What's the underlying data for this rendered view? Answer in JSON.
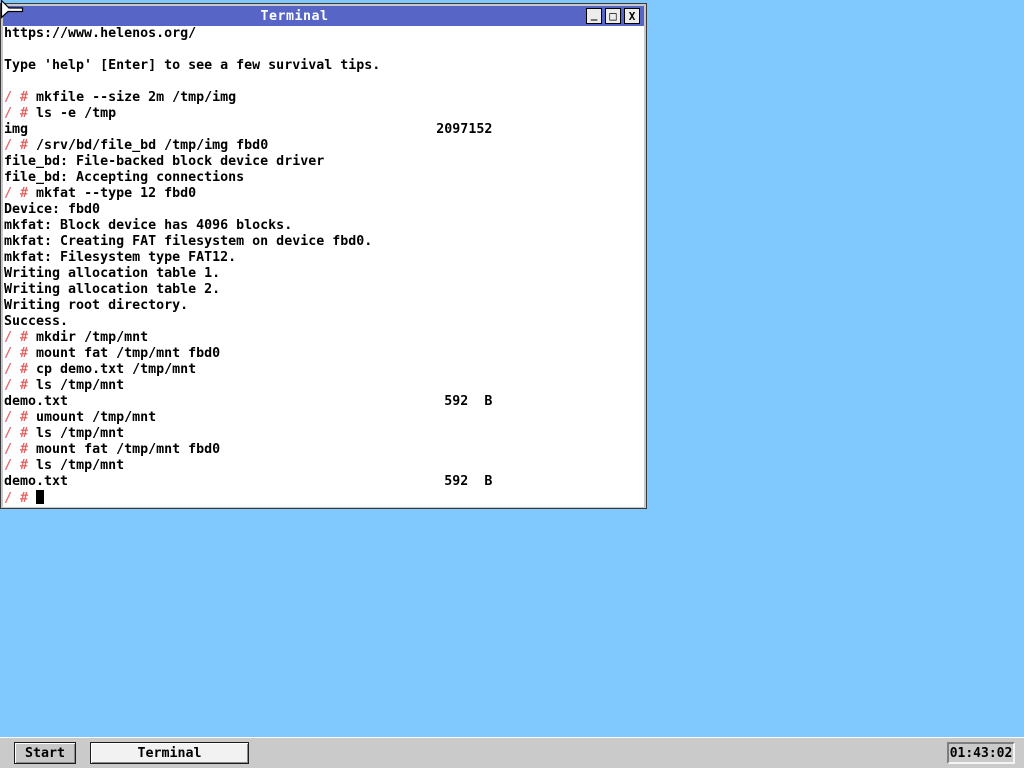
{
  "colors": {
    "desktop": "#80c9ff",
    "titlebar": "#5766c6",
    "prompt": "#e56a6a",
    "taskbar": "#cacaca",
    "window_frame": "#c8c8c8"
  },
  "window": {
    "title": "Terminal",
    "controls": {
      "minimize": "_",
      "maximize": "□",
      "close": "X"
    }
  },
  "terminal": {
    "lines": [
      {
        "text": "https://www.helenos.org/"
      },
      {
        "text": ""
      },
      {
        "text": "Type 'help' [Enter] to see a few survival tips."
      },
      {
        "text": ""
      },
      {
        "prefix": "/ #",
        "text": " mkfile --size 2m /tmp/img"
      },
      {
        "prefix": "/ #",
        "text": " ls -e /tmp"
      },
      {
        "text": "img                                                   2097152"
      },
      {
        "prefix": "/ #",
        "text": " /srv/bd/file_bd /tmp/img fbd0"
      },
      {
        "text": "file_bd: File-backed block device driver"
      },
      {
        "text": "file_bd: Accepting connections"
      },
      {
        "prefix": "/ #",
        "text": " mkfat --type 12 fbd0"
      },
      {
        "text": "Device: fbd0"
      },
      {
        "text": "mkfat: Block device has 4096 blocks."
      },
      {
        "text": "mkfat: Creating FAT filesystem on device fbd0."
      },
      {
        "text": "mkfat: Filesystem type FAT12."
      },
      {
        "text": "Writing allocation table 1."
      },
      {
        "text": "Writing allocation table 2."
      },
      {
        "text": "Writing root directory."
      },
      {
        "text": "Success."
      },
      {
        "prefix": "/ #",
        "text": " mkdir /tmp/mnt"
      },
      {
        "prefix": "/ #",
        "text": " mount fat /tmp/mnt fbd0"
      },
      {
        "prefix": "/ #",
        "text": " cp demo.txt /tmp/mnt"
      },
      {
        "prefix": "/ #",
        "text": " ls /tmp/mnt"
      },
      {
        "text": "demo.txt                                               592  B"
      },
      {
        "prefix": "/ #",
        "text": " umount /tmp/mnt"
      },
      {
        "prefix": "/ #",
        "text": " ls /tmp/mnt"
      },
      {
        "prefix": "/ #",
        "text": " mount fat /tmp/mnt fbd0"
      },
      {
        "prefix": "/ #",
        "text": " ls /tmp/mnt"
      },
      {
        "text": "demo.txt                                               592  B"
      },
      {
        "prefix": "/ #",
        "text": " ",
        "cursor": true
      }
    ]
  },
  "taskbar": {
    "start_label": "Start",
    "task_button_label": "Terminal",
    "clock": "01:43:02"
  }
}
